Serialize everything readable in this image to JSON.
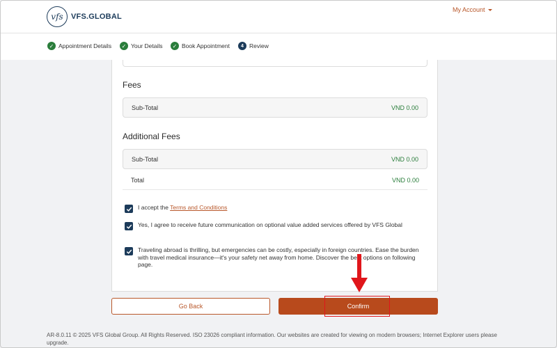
{
  "header": {
    "logo_mark": "vfs",
    "logo_text": "VFS.GLOBAL",
    "account_label": "My Account"
  },
  "steps": [
    {
      "label": "Appointment Details",
      "state": "done"
    },
    {
      "label": "Your Details",
      "state": "done"
    },
    {
      "label": "Book Appointment",
      "state": "done"
    },
    {
      "label": "Review",
      "state": "current",
      "number": "4"
    }
  ],
  "fees": {
    "title": "Fees",
    "subtotal_label": "Sub-Total",
    "subtotal_value": "VND 0.00"
  },
  "additional_fees": {
    "title": "Additional Fees",
    "subtotal_label": "Sub-Total",
    "subtotal_value": "VND 0.00",
    "total_label": "Total",
    "total_value": "VND 0.00"
  },
  "consents": {
    "terms_prefix": "I accept the ",
    "terms_link": "Terms and Conditions",
    "communication_text": "Yes, I agree to receive future communication on optional value added services offered by VFS Global",
    "insurance_text": "Traveling abroad is thrilling, but emergencies can be costly, especially in foreign countries. Ease the burden with travel medical insurance—it's your safety net away from home. Discover the best options on following page."
  },
  "actions": {
    "back_label": "Go Back",
    "confirm_label": "Confirm"
  },
  "footer": {
    "text": "AR-8.0.11 © 2025 VFS Global Group. All Rights Reserved. ISO 23026 compliant information. Our websites are created for viewing on modern browsers; Internet Explorer users please upgrade."
  },
  "colors": {
    "brand_navy": "#1c3b5a",
    "accent_orange": "#b84a1c",
    "success_green": "#2a7d3b",
    "annotation_red": "#e0161b"
  }
}
